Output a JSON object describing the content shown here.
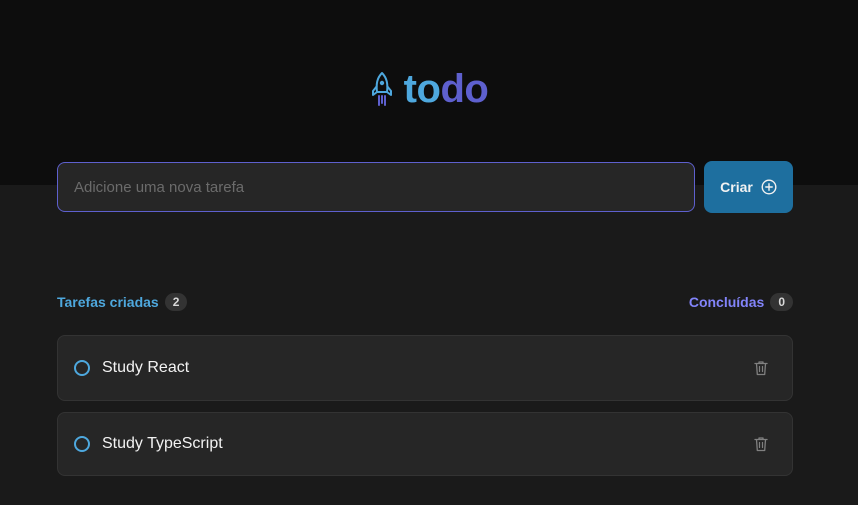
{
  "app": {
    "logo_part1": "to",
    "logo_part2": "do",
    "icon": "rocket-icon"
  },
  "new_task": {
    "placeholder": "Adicione uma nova tarefa",
    "value": "",
    "create_label": "Criar",
    "create_icon": "plus-circle-icon"
  },
  "counters": {
    "created_label": "Tarefas criadas",
    "created_count": "2",
    "done_label": "Concluídas",
    "done_count": "0"
  },
  "tasks": [
    {
      "text": "Study React",
      "done": false
    },
    {
      "text": "Study TypeScript",
      "done": false
    }
  ],
  "colors": {
    "header_bg": "#0d0d0d",
    "body_bg": "#1a1a1a",
    "blue": "#4ea8de",
    "purple": "#5e60ce",
    "purple_light": "#8284fa",
    "button": "#1e6f9f"
  }
}
